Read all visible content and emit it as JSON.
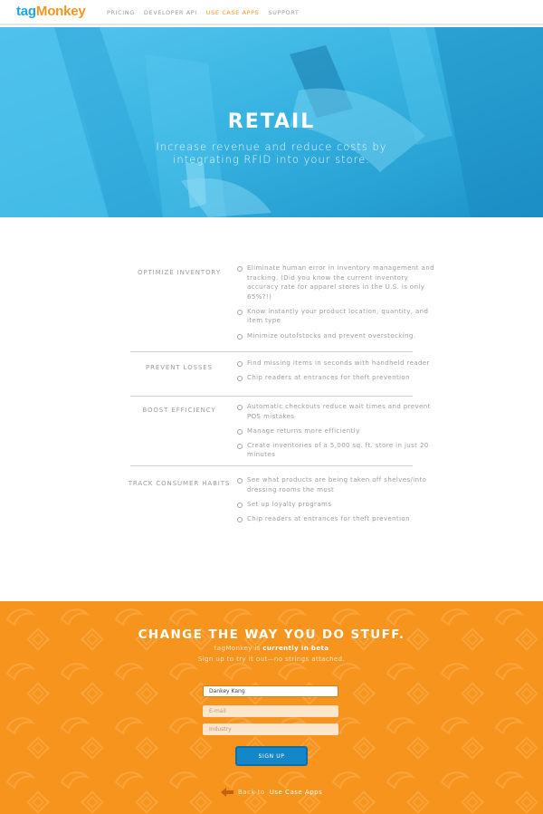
{
  "nav": {
    "logo_tag": "tag",
    "logo_monkey": "Monkey",
    "links": [
      {
        "label": "PRICING",
        "active": false
      },
      {
        "label": "DEVELOPER API",
        "active": false
      },
      {
        "label": "USE CASE APPS",
        "active": true
      },
      {
        "label": "SUPPORT",
        "active": false
      }
    ]
  },
  "hero": {
    "title": "RETAIL",
    "subtitle": "Increase revenue and reduce costs by integrating RFID into your store."
  },
  "features": [
    {
      "title": "OPTIMIZE INVENTORY",
      "items": [
        "Eliminate human error in inventory management and tracking. (Did you know the current inventory accuracy rate for apparel stores in the U.S. is only 65%?!)",
        "Know instantly your product location, quantity, and item type",
        "Minimize outofstocks and prevent overstocking."
      ]
    },
    {
      "title": "PREVENT LOSSES",
      "items": [
        "Find missing items in seconds with handheld reader",
        "Chip readers at entrances for theft prevention"
      ]
    },
    {
      "title": "BOOST EFFICIENCY",
      "items": [
        "Automatic checkouts reduce wait times and prevent POS mistakes",
        "Manage returns more efficiently",
        "Create inventories of a 5,000 sq. ft. store in just 20 minutes"
      ]
    },
    {
      "title": "TRACK CONSUMER HABITS",
      "items": [
        "See what products are being taken off shelves/into dressing rooms the most",
        "Set up loyalty programs",
        "Chip readers at entrances for theft prevention"
      ]
    }
  ],
  "cta": {
    "heading": "CHANGE THE WAY YOU DO STUFF.",
    "line1_prefix": "tagMonkey is ",
    "line1_bold": "currently in beta",
    "line2": "Sign up to try it out—no strings attached.",
    "name_value": "Dankey Kang",
    "email_placeholder": "E-mail",
    "industry_placeholder": "Industry",
    "signup_label": "SIGN UP",
    "back_prefix": "Back to ",
    "back_link": "Use Case Apps"
  },
  "colors": {
    "brand_blue": "#1ea7d9",
    "brand_orange": "#f7941d",
    "button_blue": "#1387c8"
  }
}
